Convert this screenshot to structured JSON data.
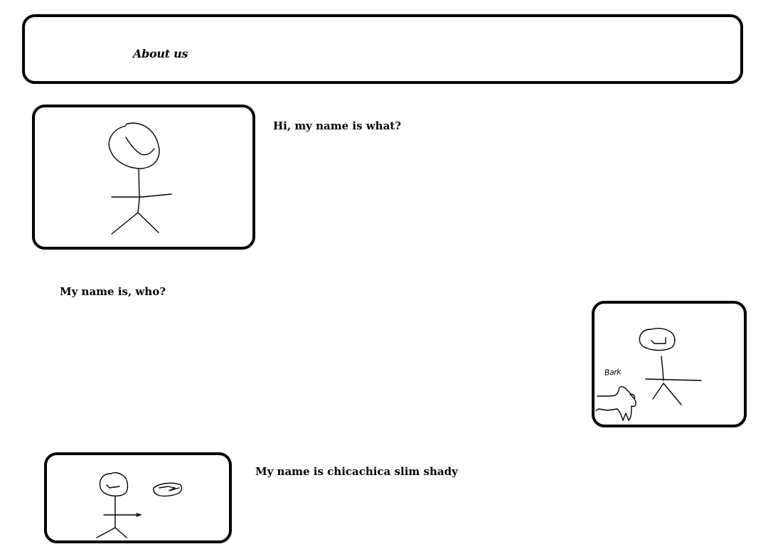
{
  "header": {
    "title": "About us"
  },
  "sections": [
    {
      "text": "Hi, my name is what?",
      "image_icon": "stick-figure-drawing"
    },
    {
      "text": "My name is, who?",
      "image_icon": "stick-figure-with-dog-drawing",
      "dog_label": "Bark"
    },
    {
      "text": "My name is chicachica slim shady",
      "image_icon": "stick-figure-with-object-drawing"
    }
  ],
  "colors": {
    "border": "#000000",
    "background": "#ffffff",
    "text": "#000000"
  }
}
